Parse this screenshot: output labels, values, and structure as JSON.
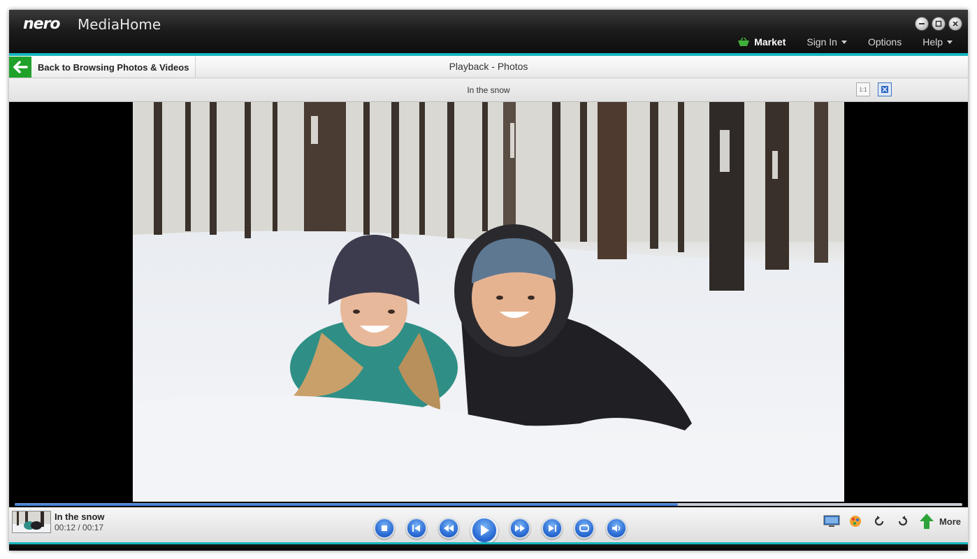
{
  "app": {
    "logo": "nero",
    "product": "MediaHome"
  },
  "window_controls": [
    {
      "name": "minimize-icon"
    },
    {
      "name": "restore-icon"
    },
    {
      "name": "close-icon"
    }
  ],
  "top_menu": {
    "market": "Market",
    "sign_in": "Sign In",
    "options": "Options",
    "help": "Help"
  },
  "nav": {
    "back_label": "Back to Browsing Photos & Videos",
    "title": "Playback - Photos"
  },
  "viewer": {
    "caption": "In the snow",
    "view_buttons": [
      "actual-size-icon",
      "fit-to-window-icon"
    ]
  },
  "now_playing": {
    "title": "In the snow",
    "time": "00:12 / 00:17",
    "progress_fraction": 0.7
  },
  "controls": [
    "stop-icon",
    "previous-icon",
    "rewind-icon",
    "play-icon",
    "fast-forward-icon",
    "next-icon",
    "repeat-icon",
    "volume-icon"
  ],
  "tools": {
    "more_label": "More",
    "icons": [
      "tv-output-icon",
      "effects-icon",
      "rotate-left-icon",
      "rotate-right-icon",
      "upload-icon"
    ]
  },
  "colors": {
    "accent_teal": "#17b5bf",
    "back_green": "#1fa12a",
    "control_blue": "#2d6ed6"
  }
}
